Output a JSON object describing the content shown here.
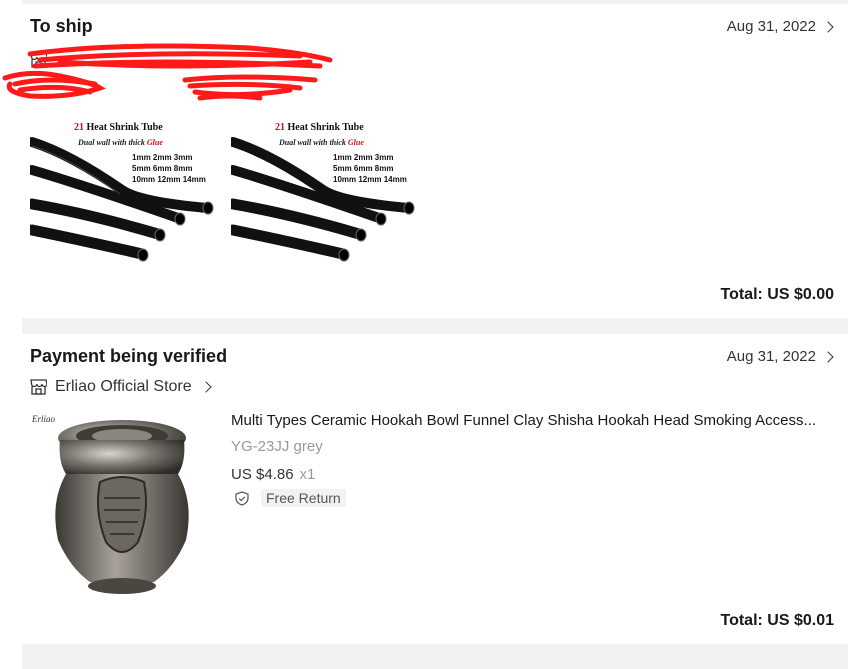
{
  "orders": [
    {
      "status": "To ship",
      "date": "Aug 31, 2022",
      "total": "Total: US $0.00",
      "thumbnails": [
        {
          "title_num": "21",
          "title_text": "Heat Shrink Tube",
          "subtitle_plain": "Dual wall with thick",
          "subtitle_red": "Glue",
          "sizes_line1": "1mm 2mm 3mm",
          "sizes_line2": "5mm 6mm 8mm",
          "sizes_line3": "10mm 12mm 14mm"
        },
        {
          "title_num": "21",
          "title_text": "Heat Shrink Tube",
          "subtitle_plain": "Dual wall with thick",
          "subtitle_red": "Glue",
          "sizes_line1": "1mm 2mm 3mm",
          "sizes_line2": "5mm 6mm 8mm",
          "sizes_line3": "10mm 12mm 14mm"
        }
      ]
    },
    {
      "status": "Payment being verified",
      "date": "Aug 31, 2022",
      "store": "Erliao Official Store",
      "brand_mark": "Erliao",
      "product": {
        "title": "Multi Types Ceramic Hookah Bowl Funnel Clay Shisha Hookah Head Smoking Access...",
        "variant": "YG-23JJ grey",
        "price": "US $4.86",
        "qty": "x1",
        "badge": "Free Return"
      },
      "total": "Total: US $0.01"
    }
  ],
  "colors": {
    "accent_red": "#c0151b",
    "scribble_red": "#ff1a1a",
    "separator": "#f2f2f2",
    "muted_text": "#999999"
  },
  "icons": [
    "store-icon",
    "chevron-right-icon",
    "shield-check-icon"
  ]
}
